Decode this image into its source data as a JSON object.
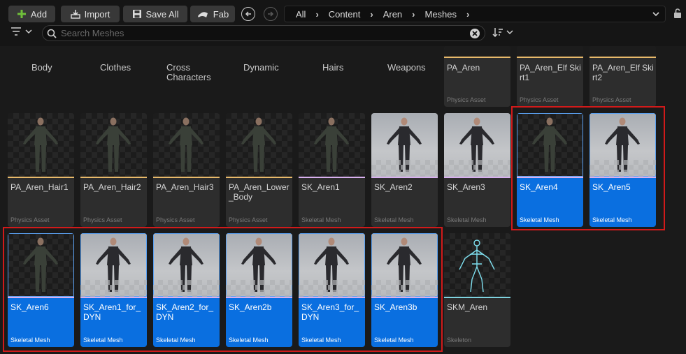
{
  "toolbar": {
    "add_label": "Add",
    "import_label": "Import",
    "save_all_label": "Save All",
    "fab_label": "Fab"
  },
  "breadcrumb": [
    "All",
    "Content",
    "Aren",
    "Meshes"
  ],
  "search": {
    "placeholder": "Search Meshes",
    "value": ""
  },
  "folders": [
    "Body",
    "Clothes",
    "Cross Characters",
    "Dynamic",
    "Hairs",
    "Weapons"
  ],
  "assets_top": [
    {
      "name": "PA_Aren",
      "type": "Physics Asset"
    },
    {
      "name": "PA_Aren_Elf Skirt1",
      "type": "Physics Asset"
    },
    {
      "name": "PA_Aren_Elf Skirt2",
      "type": "Physics Asset"
    }
  ],
  "assets_row2": [
    {
      "name": "PA_Aren_Hair1",
      "type": "Physics Asset",
      "selected": false,
      "thumb": "dark",
      "bar": "#e8b96a"
    },
    {
      "name": "PA_Aren_Hair2",
      "type": "Physics Asset",
      "selected": false,
      "thumb": "dark",
      "bar": "#e8b96a"
    },
    {
      "name": "PA_Aren_Hair3",
      "type": "Physics Asset",
      "selected": false,
      "thumb": "dark",
      "bar": "#e8b96a"
    },
    {
      "name": "PA_Aren_Lower_Body",
      "type": "Physics Asset",
      "selected": false,
      "thumb": "dark",
      "bar": "#e8b96a"
    },
    {
      "name": "SK_Aren1",
      "type": "Skeletal Mesh",
      "selected": false,
      "thumb": "dark",
      "bar": "#d8b0ef"
    },
    {
      "name": "SK_Aren2",
      "type": "Skeletal Mesh",
      "selected": false,
      "thumb": "grey",
      "bar": "#d8b0ef"
    },
    {
      "name": "SK_Aren3",
      "type": "Skeletal Mesh",
      "selected": false,
      "thumb": "grey",
      "bar": "#d8b0ef"
    },
    {
      "name": "SK_Aren4",
      "type": "Skeletal Mesh",
      "selected": true,
      "thumb": "dark",
      "bar": "#d8b0ef"
    },
    {
      "name": "SK_Aren5",
      "type": "Skeletal Mesh",
      "selected": true,
      "thumb": "grey",
      "bar": "#d8b0ef"
    }
  ],
  "assets_row3": [
    {
      "name": "SK_Aren6",
      "type": "Skeletal Mesh",
      "selected": true,
      "thumb": "dark",
      "bar": "#d8b0ef"
    },
    {
      "name": "SK_Aren1_for_DYN",
      "type": "Skeletal Mesh",
      "selected": true,
      "thumb": "grey",
      "bar": "#d8b0ef"
    },
    {
      "name": "SK_Aren2_for_DYN",
      "type": "Skeletal Mesh",
      "selected": true,
      "thumb": "grey",
      "bar": "#d8b0ef"
    },
    {
      "name": "SK_Aren2b",
      "type": "Skeletal Mesh",
      "selected": true,
      "thumb": "grey",
      "bar": "#d8b0ef"
    },
    {
      "name": "SK_Aren3_for_DYN",
      "type": "Skeletal Mesh",
      "selected": true,
      "thumb": "grey",
      "bar": "#d8b0ef"
    },
    {
      "name": "SK_Aren3b",
      "type": "Skeletal Mesh",
      "selected": true,
      "thumb": "grey",
      "bar": "#d8b0ef"
    },
    {
      "name": "SKM_Aren",
      "type": "Skeleton",
      "selected": false,
      "thumb": "dark",
      "bar": "#7fd3e0"
    }
  ],
  "colors": {
    "selection": "#0a6fe0",
    "highlight": "#d11a1a",
    "add_icon": "#6fbf3a",
    "physics_asset_bar": "#e8b96a",
    "skeletal_mesh_bar": "#d8b0ef"
  }
}
